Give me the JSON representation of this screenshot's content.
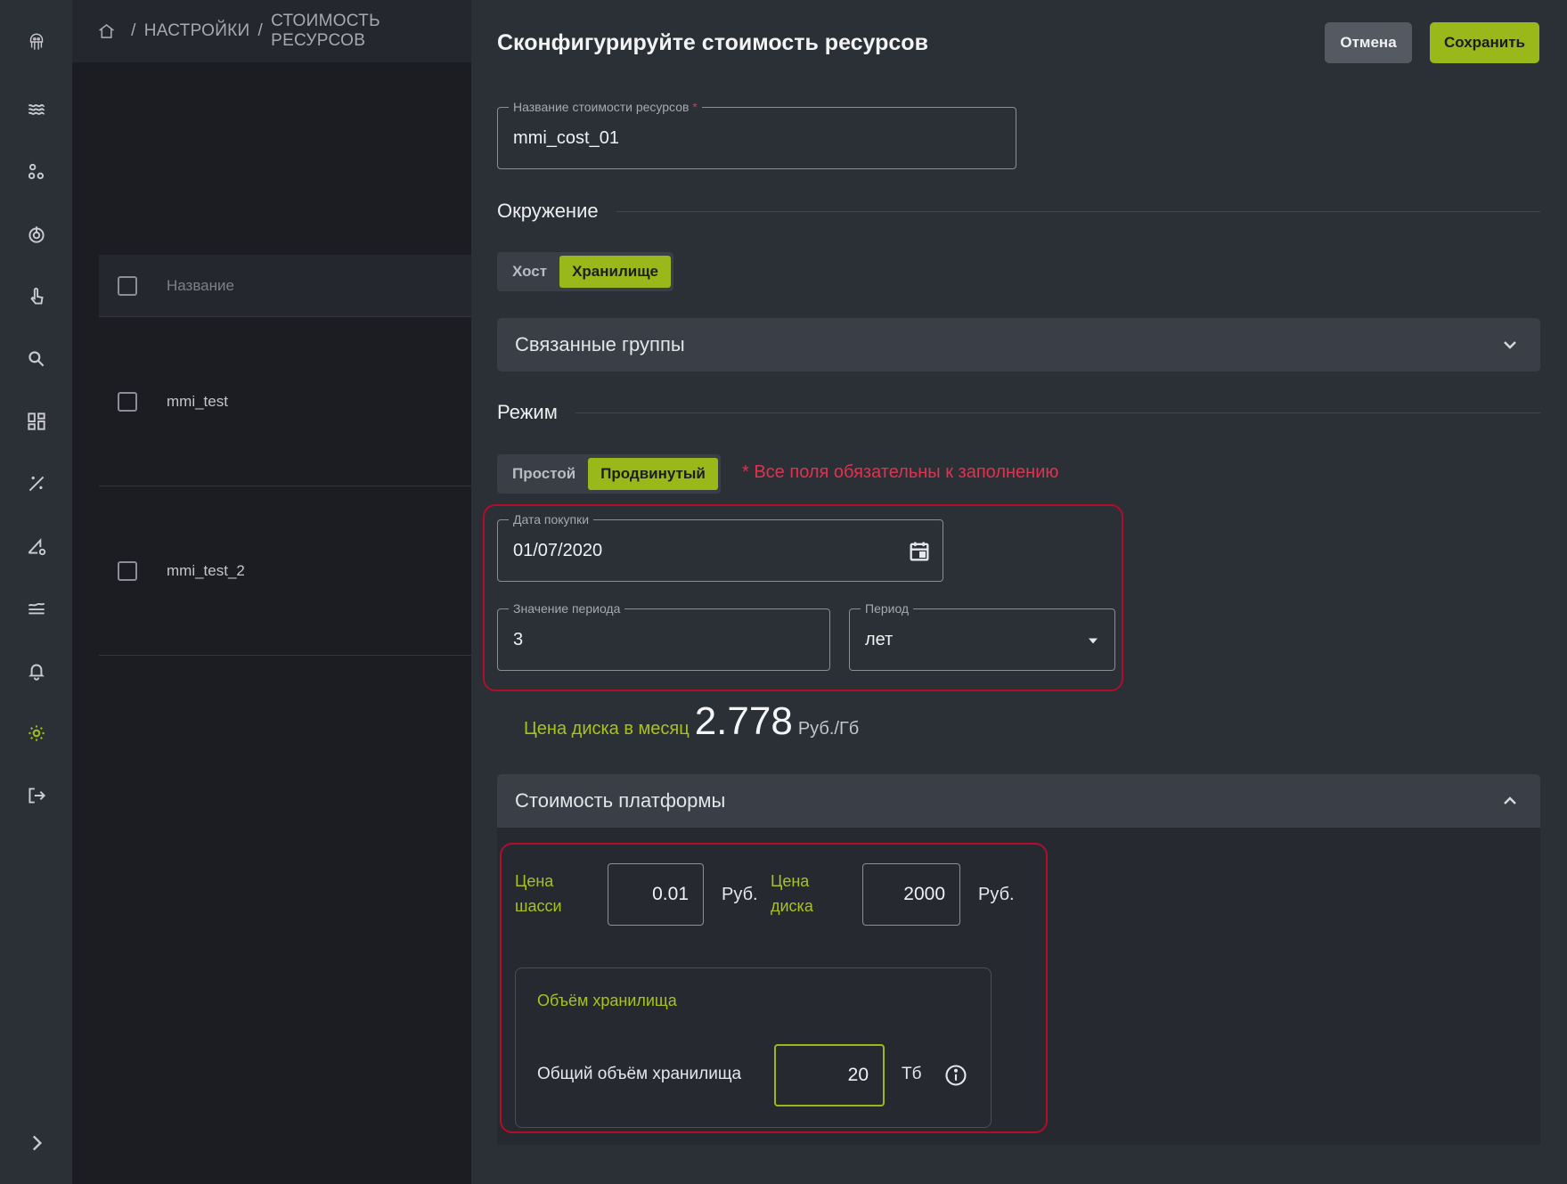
{
  "breadcrumb": {
    "sep": "/",
    "items": [
      "НАСТРОЙКИ",
      "СТОИМОСТЬ РЕСУРСОВ"
    ]
  },
  "table": {
    "header": "Название",
    "rows": [
      "mmi_test",
      "mmi_test_2"
    ]
  },
  "drawer": {
    "title": "Сконфигурируйте стоимость ресурсов",
    "cancel_label": "Отмена",
    "save_label": "Сохранить",
    "name_field": {
      "label": "Название стоимости ресурсов",
      "required_mark": "*",
      "value": "mmi_cost_01"
    },
    "environment": {
      "heading": "Окружение",
      "options": [
        "Хост",
        "Хранилище"
      ],
      "selected": "Хранилище"
    },
    "related_groups": {
      "label": "Связанные группы"
    },
    "mode": {
      "heading": "Режим",
      "options": [
        "Простой",
        "Продвинутый"
      ],
      "selected": "Продвинутый",
      "required_note": "* Все поля обязательны к заполнению"
    },
    "purchase_date": {
      "label": "Дата покупки",
      "value": "01/07/2020"
    },
    "period_value": {
      "label": "Значение периода",
      "value": "3"
    },
    "period": {
      "label": "Период",
      "value": "лет"
    },
    "disk_price": {
      "label": "Цена диска в месяц",
      "value": "2.778",
      "unit": "Руб./Гб"
    },
    "platform_cost": {
      "label": "Стоимость платформы",
      "chassis_label_1": "Цена",
      "chassis_label_2": "шасси",
      "chassis_value": "0.01",
      "chassis_unit": "Руб.",
      "disk_label_1": "Цена",
      "disk_label_2": "диска",
      "disk_value": "2000",
      "disk_unit": "Руб.",
      "storage": {
        "heading": "Объём хранилища",
        "total_label": "Общий объём хранилища",
        "total_value": "20",
        "total_unit": "Тб"
      }
    }
  },
  "colors": {
    "accent": "#9ab81a",
    "error": "#e0334f",
    "highlight_box": "#b00e2b"
  }
}
